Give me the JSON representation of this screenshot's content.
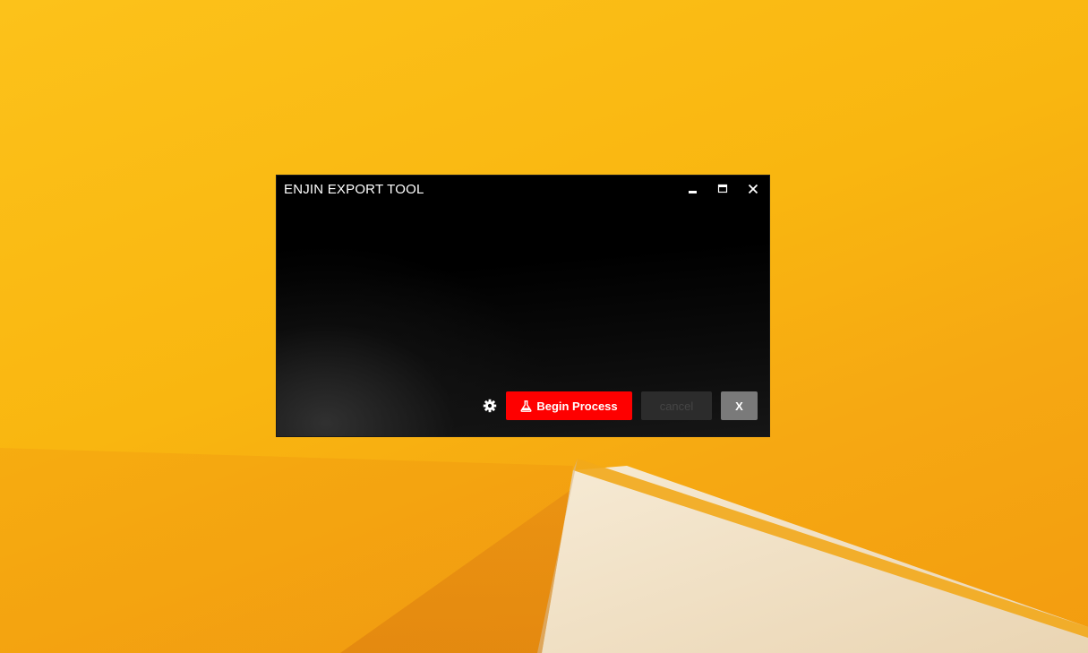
{
  "window": {
    "title": "ENJIN EXPORT TOOL",
    "controls": {
      "minimize_icon": "minimize-icon",
      "maximize_icon": "maximize-icon",
      "close_icon": "close-icon"
    }
  },
  "toolbar": {
    "settings_icon": "gear-icon",
    "begin_icon": "flask-icon",
    "begin_label": "Begin Process",
    "cancel_label": "cancel",
    "close_label": "X"
  },
  "colors": {
    "desktop_accent": "#f9b610",
    "begin_button": "#fe0000",
    "cancel_button": "#2c2c2c",
    "close_button": "#7a7a7a"
  }
}
